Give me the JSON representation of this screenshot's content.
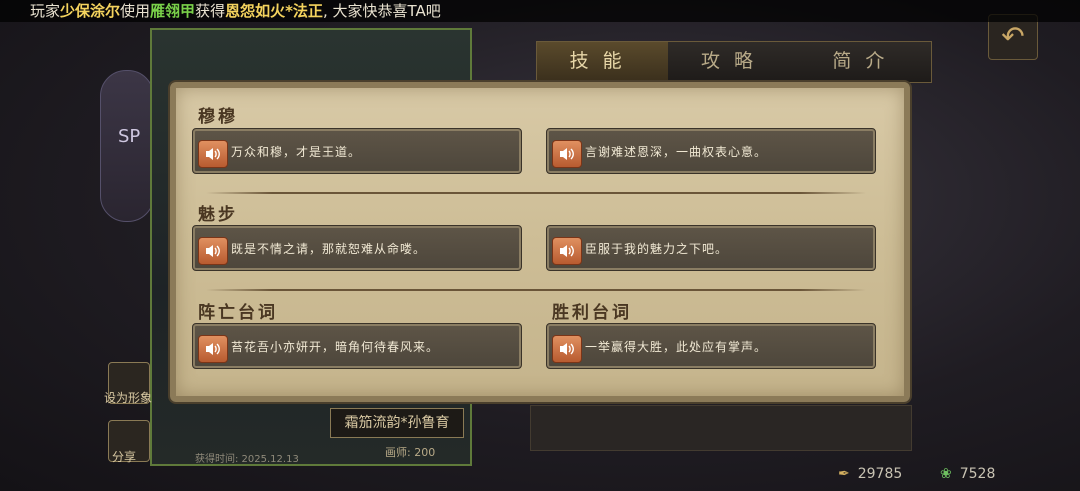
{
  "broadcast": {
    "prefix": "玩家",
    "player": "少保涂尔",
    "verb": "使用",
    "item": "雁翎甲",
    "obtained": "获得",
    "skin": "恩怨如火*法正",
    "suffix": ", 大家快恭喜TA吧"
  },
  "side": {
    "sp_label": "SP",
    "set_image_label": "设为形象",
    "share_label": "分享"
  },
  "tabs": [
    {
      "label": "技能",
      "active": true
    },
    {
      "label": "攻略",
      "active": false
    },
    {
      "label": "简介",
      "active": false
    }
  ],
  "hero_card": {
    "name_plate": "霜笳流韵*孙鲁育",
    "painter": "画师: 200",
    "acquired": "获得时间: 2025.12.13"
  },
  "currency": {
    "gold_value": "29785",
    "jade_value": "7528"
  },
  "dialog": {
    "sections": [
      {
        "title": "穆穆",
        "lines": [
          "万众和穆，才是王道。",
          "言谢难述恩深，一曲权表心意。"
        ]
      },
      {
        "title": "魅步",
        "lines": [
          "既是不情之请，那就恕难从命喽。",
          "臣服于我的魅力之下吧。"
        ]
      }
    ],
    "battle_start_title": "阵亡台词",
    "battle_start_line": "苔花吾小亦妍开，暗角何待春风来。",
    "victory_title": "胜利台词",
    "victory_line": "一举赢得大胜，此处应有掌声。"
  }
}
